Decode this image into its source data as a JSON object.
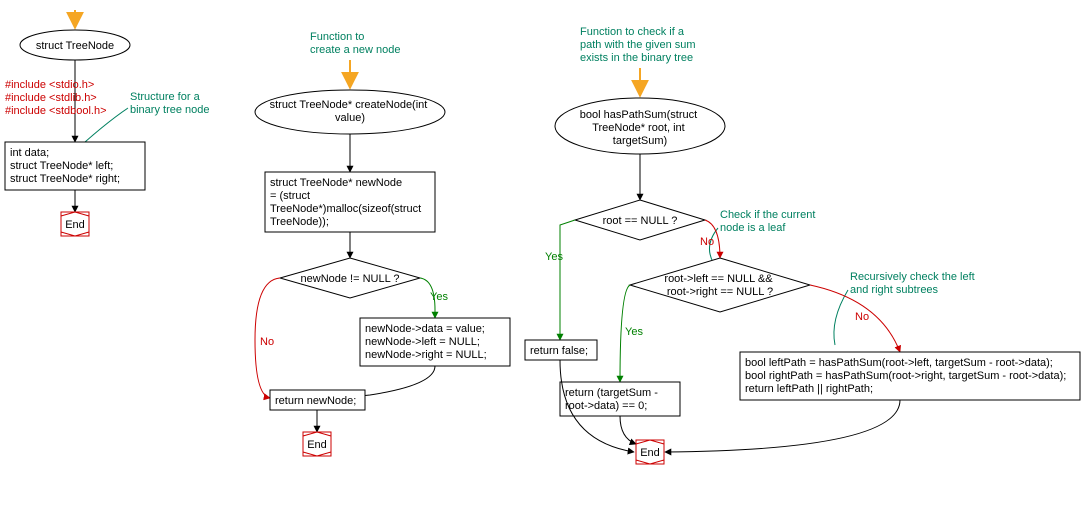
{
  "col1": {
    "start": "struct TreeNode",
    "includes": [
      "#include <stdio.h>",
      "#include <stdlib.h>",
      "#include <stdbool.h>"
    ],
    "comment": "Structure for a\nbinary tree node",
    "body": "int data;\nstruct TreeNode* left;\nstruct TreeNode* right;",
    "end": "End"
  },
  "col2": {
    "top_comment": "Function to\ncreate a new node",
    "start": "struct TreeNode* createNode(int\nvalue)",
    "alloc": "struct TreeNode* newNode\n= (struct\nTreeNode*)malloc(sizeof(struct\nTreeNode));",
    "cond": "newNode != NULL ?",
    "yes": "Yes",
    "no": "No",
    "assign": "newNode->data = value;\nnewNode->left = NULL;\nnewNode->right = NULL;",
    "ret": "return newNode;",
    "end": "End"
  },
  "col3": {
    "top_comment": "Function to check if a\npath with the given sum\nexists in the binary tree",
    "start": "bool hasPathSum(struct\nTreeNode* root, int\ntargetSum)",
    "cond1": "root == NULL ?",
    "comment_leaf": "Check if the current\nnode is a leaf",
    "cond2": "root->left == NULL &&\nroot->right == NULL ?",
    "comment_recur": "Recursively check the left\nand right subtrees",
    "ret_false": "return false;",
    "ret_leaf": "return (targetSum -\nroot->data) == 0;",
    "recur": "bool leftPath = hasPathSum(root->left, targetSum - root->data);\nbool rightPath = hasPathSum(root->right, targetSum - root->data);\nreturn leftPath || rightPath;",
    "yes": "Yes",
    "no": "No",
    "end": "End"
  }
}
